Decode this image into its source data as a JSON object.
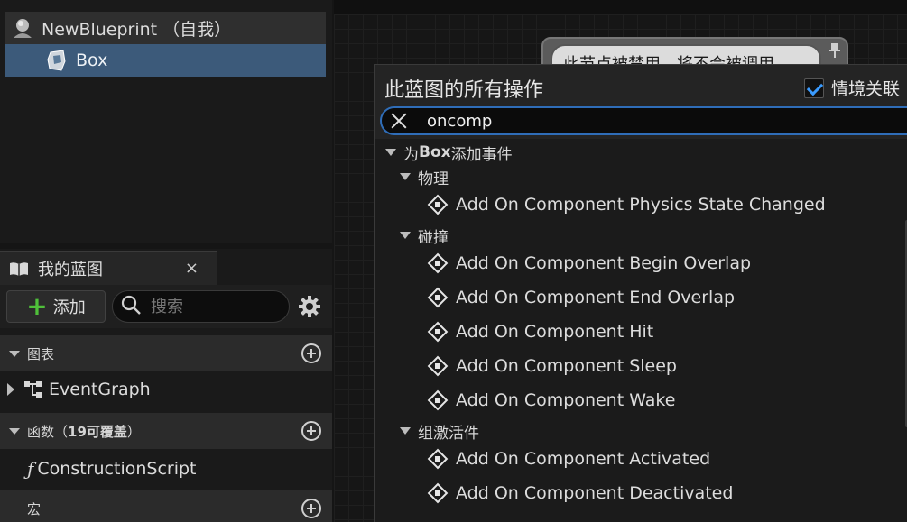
{
  "components": {
    "root_label": "NewBlueprint （自我）",
    "child_label": "Box"
  },
  "my_blueprint": {
    "tab_label": "我的蓝图",
    "close_glyph": "×",
    "add_label": "添加",
    "search_placeholder": "搜索",
    "sections": {
      "graphs": "图表",
      "functions_prefix": "函数（",
      "functions_count": "19可覆盖",
      "functions_suffix": "）",
      "macros": "宏"
    },
    "items": {
      "event_graph": "EventGraph",
      "construction_script": "ConstructionScript"
    }
  },
  "graph": {
    "disabled_node_text": "此节点被禁用，将不会被调用。"
  },
  "action_menu": {
    "title": "此蓝图的所有操作",
    "context_sensitive_label": "情境关联",
    "context_sensitive_checked": true,
    "search_value": "oncomp",
    "root_category_prefix": "为 ",
    "root_category_bold": "Box",
    "root_category_suffix": "添加事件",
    "categories": [
      {
        "label": "物理",
        "items": [
          "Add On Component Physics State Changed"
        ]
      },
      {
        "label": "碰撞",
        "items": [
          "Add On Component Begin Overlap",
          "Add On Component End Overlap",
          "Add On Component Hit",
          "Add On Component Sleep",
          "Add On Component Wake"
        ]
      },
      {
        "label": "组激活件",
        "items": [
          "Add On Component Activated",
          "Add On Component Deactivated"
        ]
      }
    ]
  },
  "colors": {
    "selected_row": "#3c5a7a",
    "accent_blue": "#3a9bff",
    "add_green": "#4fbf3a",
    "search_focus": "#2f6db8"
  },
  "icons": {
    "root": "actor-bust-icon",
    "box": "box-collision-icon",
    "book": "book-icon",
    "search": "search-icon",
    "gear": "gear-icon",
    "event_graph": "graph-icon",
    "function": "function-icon",
    "event": "event-diamond-icon",
    "clear": "close-icon"
  }
}
